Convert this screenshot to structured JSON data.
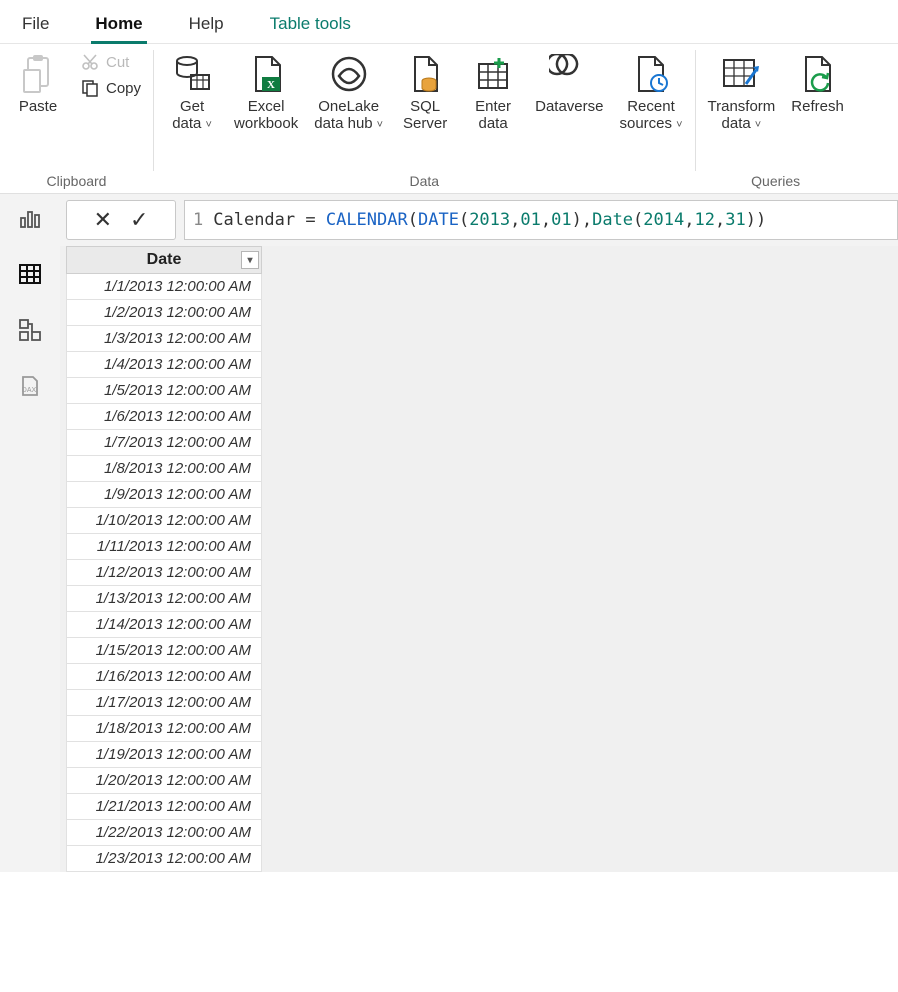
{
  "tabs": [
    {
      "id": "file",
      "label": "File"
    },
    {
      "id": "home",
      "label": "Home",
      "active": true
    },
    {
      "id": "help",
      "label": "Help"
    },
    {
      "id": "tabletools",
      "label": "Table tools",
      "context": true
    }
  ],
  "ribbon": {
    "clipboard": {
      "label": "Clipboard",
      "paste": "Paste",
      "cut": "Cut",
      "copy": "Copy"
    },
    "data": {
      "label": "Data",
      "get_data": "Get\ndata",
      "excel": "Excel\nworkbook",
      "onelake": "OneLake\ndata hub",
      "sql": "SQL\nServer",
      "enter": "Enter\ndata",
      "dataverse": "Dataverse",
      "recent": "Recent\nsources"
    },
    "queries": {
      "label": "Queries",
      "transform": "Transform\ndata",
      "refresh": "Refresh"
    }
  },
  "formula": {
    "line": "1",
    "tokens": [
      {
        "t": "Calendar = ",
        "c": ""
      },
      {
        "t": "CALENDAR",
        "c": "kw"
      },
      {
        "t": "(",
        "c": ""
      },
      {
        "t": "DATE",
        "c": "kw"
      },
      {
        "t": "(",
        "c": ""
      },
      {
        "t": "2013",
        "c": "num"
      },
      {
        "t": ",",
        "c": ""
      },
      {
        "t": "01",
        "c": "num"
      },
      {
        "t": ",",
        "c": ""
      },
      {
        "t": "01",
        "c": "num"
      },
      {
        "t": "),",
        "c": ""
      },
      {
        "t": "Date",
        "c": "fn"
      },
      {
        "t": "(",
        "c": ""
      },
      {
        "t": "2014",
        "c": "num"
      },
      {
        "t": ",",
        "c": ""
      },
      {
        "t": "12",
        "c": "num"
      },
      {
        "t": ",",
        "c": ""
      },
      {
        "t": "31",
        "c": "num"
      },
      {
        "t": "))",
        "c": ""
      }
    ]
  },
  "table": {
    "header": "Date",
    "rows": [
      "1/1/2013 12:00:00 AM",
      "1/2/2013 12:00:00 AM",
      "1/3/2013 12:00:00 AM",
      "1/4/2013 12:00:00 AM",
      "1/5/2013 12:00:00 AM",
      "1/6/2013 12:00:00 AM",
      "1/7/2013 12:00:00 AM",
      "1/8/2013 12:00:00 AM",
      "1/9/2013 12:00:00 AM",
      "1/10/2013 12:00:00 AM",
      "1/11/2013 12:00:00 AM",
      "1/12/2013 12:00:00 AM",
      "1/13/2013 12:00:00 AM",
      "1/14/2013 12:00:00 AM",
      "1/15/2013 12:00:00 AM",
      "1/16/2013 12:00:00 AM",
      "1/17/2013 12:00:00 AM",
      "1/18/2013 12:00:00 AM",
      "1/19/2013 12:00:00 AM",
      "1/20/2013 12:00:00 AM",
      "1/21/2013 12:00:00 AM",
      "1/22/2013 12:00:00 AM",
      "1/23/2013 12:00:00 AM"
    ]
  }
}
